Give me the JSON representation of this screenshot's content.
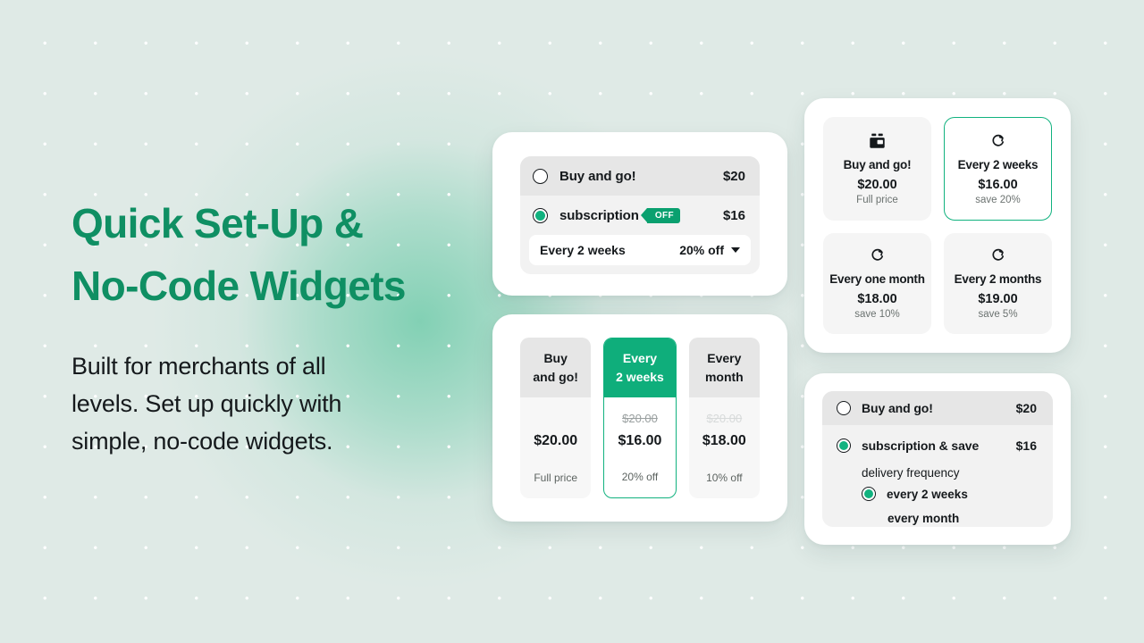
{
  "hero": {
    "heading_line1": "Quick Set-Up &",
    "heading_line2": "No-Code Widgets",
    "body_line1": "Built for merchants of all",
    "body_line2": "levels. Set up quickly with",
    "body_line3": "simple, no-code widgets.",
    "heading_color": "#0f8f63",
    "body_color": "#15191c"
  },
  "theme": {
    "background": "#dfeae6",
    "accent_green": "#11b27f",
    "accent_green_dark": "#0fae7b",
    "tag_green": "#0aa06f",
    "card_bg": "#ffffff",
    "row_shaded": "#e6e6e6",
    "row_plain": "#f2f2f2"
  },
  "widget_radio_basic": {
    "name": "basic-radio-widget",
    "rows": [
      {
        "label": "Buy and go!",
        "price": "$20",
        "selected": false,
        "badge": null
      },
      {
        "label": "subscription",
        "price": "$16",
        "selected": true,
        "badge": "OFF"
      }
    ],
    "frequency_select": {
      "value": "Every 2 weeks",
      "discount": "20% off",
      "caret": "chevron-down-icon"
    }
  },
  "widget_columns": {
    "name": "three-column-plan-widget",
    "columns": [
      {
        "title_line1": "Buy",
        "title_line2": "and go!",
        "strike": "",
        "price": "$20.00",
        "note": "Full price",
        "selected": false,
        "strike_style": "blank"
      },
      {
        "title_line1": "Every",
        "title_line2": "2 weeks",
        "strike": "$20.00",
        "price": "$16.00",
        "note": "20% off",
        "selected": true,
        "strike_style": "normal"
      },
      {
        "title_line1": "Every",
        "title_line2": "month",
        "strike": "$20.00",
        "price": "$18.00",
        "note": "10% off",
        "selected": false,
        "strike_style": "faded"
      }
    ]
  },
  "widget_tiles": {
    "name": "tile-grid-plan-widget",
    "tiles": [
      {
        "icon": "shopping-basket-icon",
        "title": "Buy and go!",
        "price": "$20.00",
        "note": "Full price",
        "selected": false
      },
      {
        "icon": "recurring-arrow-icon",
        "title": "Every 2 weeks",
        "price": "$16.00",
        "note": "save 20%",
        "selected": true
      },
      {
        "icon": "recurring-arrow-icon",
        "title": "Every one month",
        "price": "$18.00",
        "note": "save 10%",
        "selected": false
      },
      {
        "icon": "recurring-arrow-icon",
        "title": "Every 2 months",
        "price": "$19.00",
        "note": "save 5%",
        "selected": false
      }
    ]
  },
  "widget_radio_nested": {
    "name": "nested-radio-widget",
    "row_buy": {
      "label": "Buy and go!",
      "price": "$20",
      "selected": false
    },
    "row_subscription": {
      "label": "subscription & save",
      "price": "$16",
      "selected": true
    },
    "sub_heading": "delivery frequency",
    "sub_options": [
      {
        "label": "every 2 weeks",
        "selected": true
      },
      {
        "label": "every month",
        "selected": false
      }
    ]
  }
}
